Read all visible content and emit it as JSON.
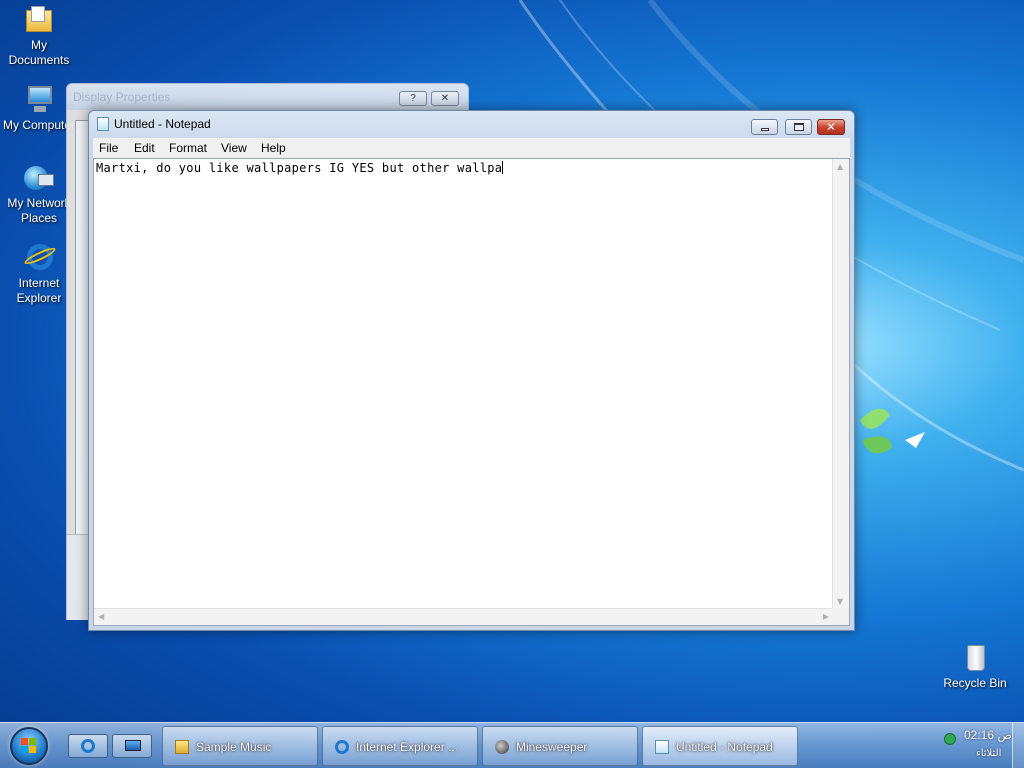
{
  "desktop": {
    "icons": [
      {
        "label": "My\nDocuments",
        "icon": "folder-documents-icon"
      },
      {
        "label": "My Computer",
        "icon": "computer-icon"
      },
      {
        "label": "My Network\nPlaces",
        "icon": "network-places-icon"
      },
      {
        "label": "Internet\nExplorer",
        "icon": "internet-explorer-icon"
      },
      {
        "label": "Recycle Bin",
        "icon": "recycle-bin-icon"
      }
    ]
  },
  "display_properties": {
    "title": "Display Properties",
    "help_label": "?",
    "close_label": "✕"
  },
  "notepad": {
    "title": "Untitled - Notepad",
    "menu": [
      "File",
      "Edit",
      "Format",
      "View",
      "Help"
    ],
    "content": "Martxi, do you like wallpapers IG YES but other wallpa"
  },
  "taskbar": {
    "tasks": [
      {
        "label": "Sample Music",
        "icon": "folder-icon"
      },
      {
        "label": "Internet Explorer ...",
        "icon": "internet-explorer-icon"
      },
      {
        "label": "Minesweeper",
        "icon": "minesweeper-icon"
      },
      {
        "label": "Untitled - Notepad",
        "icon": "notepad-icon"
      }
    ],
    "quick_launch": [
      "internet-explorer-icon",
      "show-desktop-icon"
    ],
    "clock": "02:16 ص",
    "day": "الثلاثاء"
  }
}
